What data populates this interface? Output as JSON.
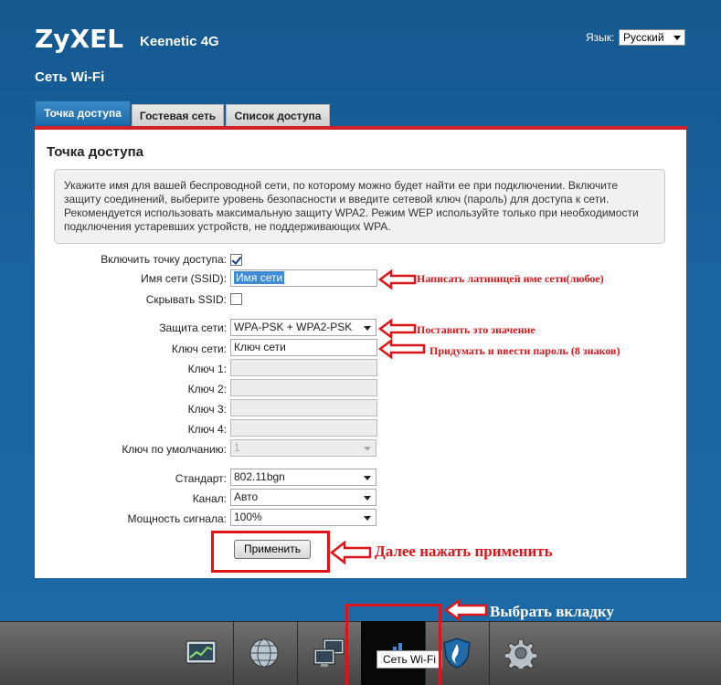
{
  "header": {
    "logo": "ZyXEL",
    "model": "Keenetic 4G",
    "language_label": "Язык:",
    "language_value": "Русский",
    "page_title": "Сеть Wi-Fi"
  },
  "tabs": [
    {
      "label": "Точка доступа",
      "active": true
    },
    {
      "label": "Гостевая сеть",
      "active": false
    },
    {
      "label": "Список доступа",
      "active": false
    }
  ],
  "panel": {
    "heading": "Точка доступа",
    "info": "Укажите имя для вашей беспроводной сети, по которому можно будет найти ее при подключении. Включите защиту соединений, выберите уровень безопасности и введите сетевой ключ (пароль) для доступа к сети. Рекомендуется использовать максимальную защиту WPA2. Режим WEP используйте только при необходимости подключения устаревших устройств, не поддерживающих WPA."
  },
  "form": {
    "enable_label": "Включить точку доступа:",
    "enable_checked": true,
    "ssid_label": "Имя сети (SSID):",
    "ssid_value": "Имя сети",
    "hide_label": "Скрывать SSID:",
    "hide_checked": false,
    "security_label": "Защита сети:",
    "security_value": "WPA-PSK + WPA2-PSK",
    "key_label": "Ключ сети:",
    "key_value": "Ключ сети",
    "key1_label": "Ключ 1:",
    "key2_label": "Ключ 2:",
    "key3_label": "Ключ 3:",
    "key4_label": "Ключ 4:",
    "default_key_label": "Ключ по умолчанию:",
    "default_key_value": "1",
    "standard_label": "Стандарт:",
    "standard_value": "802.11bgn",
    "channel_label": "Канал:",
    "channel_value": "Авто",
    "power_label": "Мощность сигнала:",
    "power_value": "100%",
    "apply_label": "Применить"
  },
  "annotations": {
    "ssid_note": "Написать латиницей име сети(любое)",
    "security_note": "Поставить это значение",
    "key_note": "Придумать и ввести пароль (8 знаков)",
    "apply_note": "Далее нажать применить",
    "tab_note": "Выбрать вкладку"
  },
  "bottom_nav": {
    "items": [
      "monitor-icon",
      "globe-icon",
      "network-icon",
      "wifi-signal-icon",
      "shield-icon",
      "gear-icon"
    ],
    "active_tooltip": "Сеть Wi-Fi"
  },
  "colors": {
    "background": "#1a64a0",
    "accent_red": "#d0202a",
    "annotation_red": "#e01418",
    "tab_active": "#2a7bbd"
  }
}
